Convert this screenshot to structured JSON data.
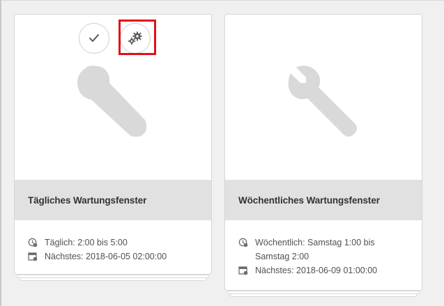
{
  "cards": [
    {
      "title": "Tägliches Wartungsfenster",
      "schedule": "Täglich: 2:00 bis 5:00",
      "next": "Nächstes: 2018-06-05 02:00:00"
    },
    {
      "title": "Wöchentliches Wartungsfenster",
      "schedule": "Wöchentlich: Samstag 1:00 bis Samstag 2:00",
      "next": "Nächstes: 2018-06-09 01:00:00"
    }
  ],
  "icons": {
    "thumbnail": "wrench-icon",
    "select": "checkmark-icon",
    "configure": "gears-icon",
    "schedule": "clock-icon",
    "next": "calendar-icon"
  },
  "colors": {
    "highlight": "#e0101a",
    "title_bar": "#e1e1e1",
    "wrench": "#d9d9d9"
  }
}
